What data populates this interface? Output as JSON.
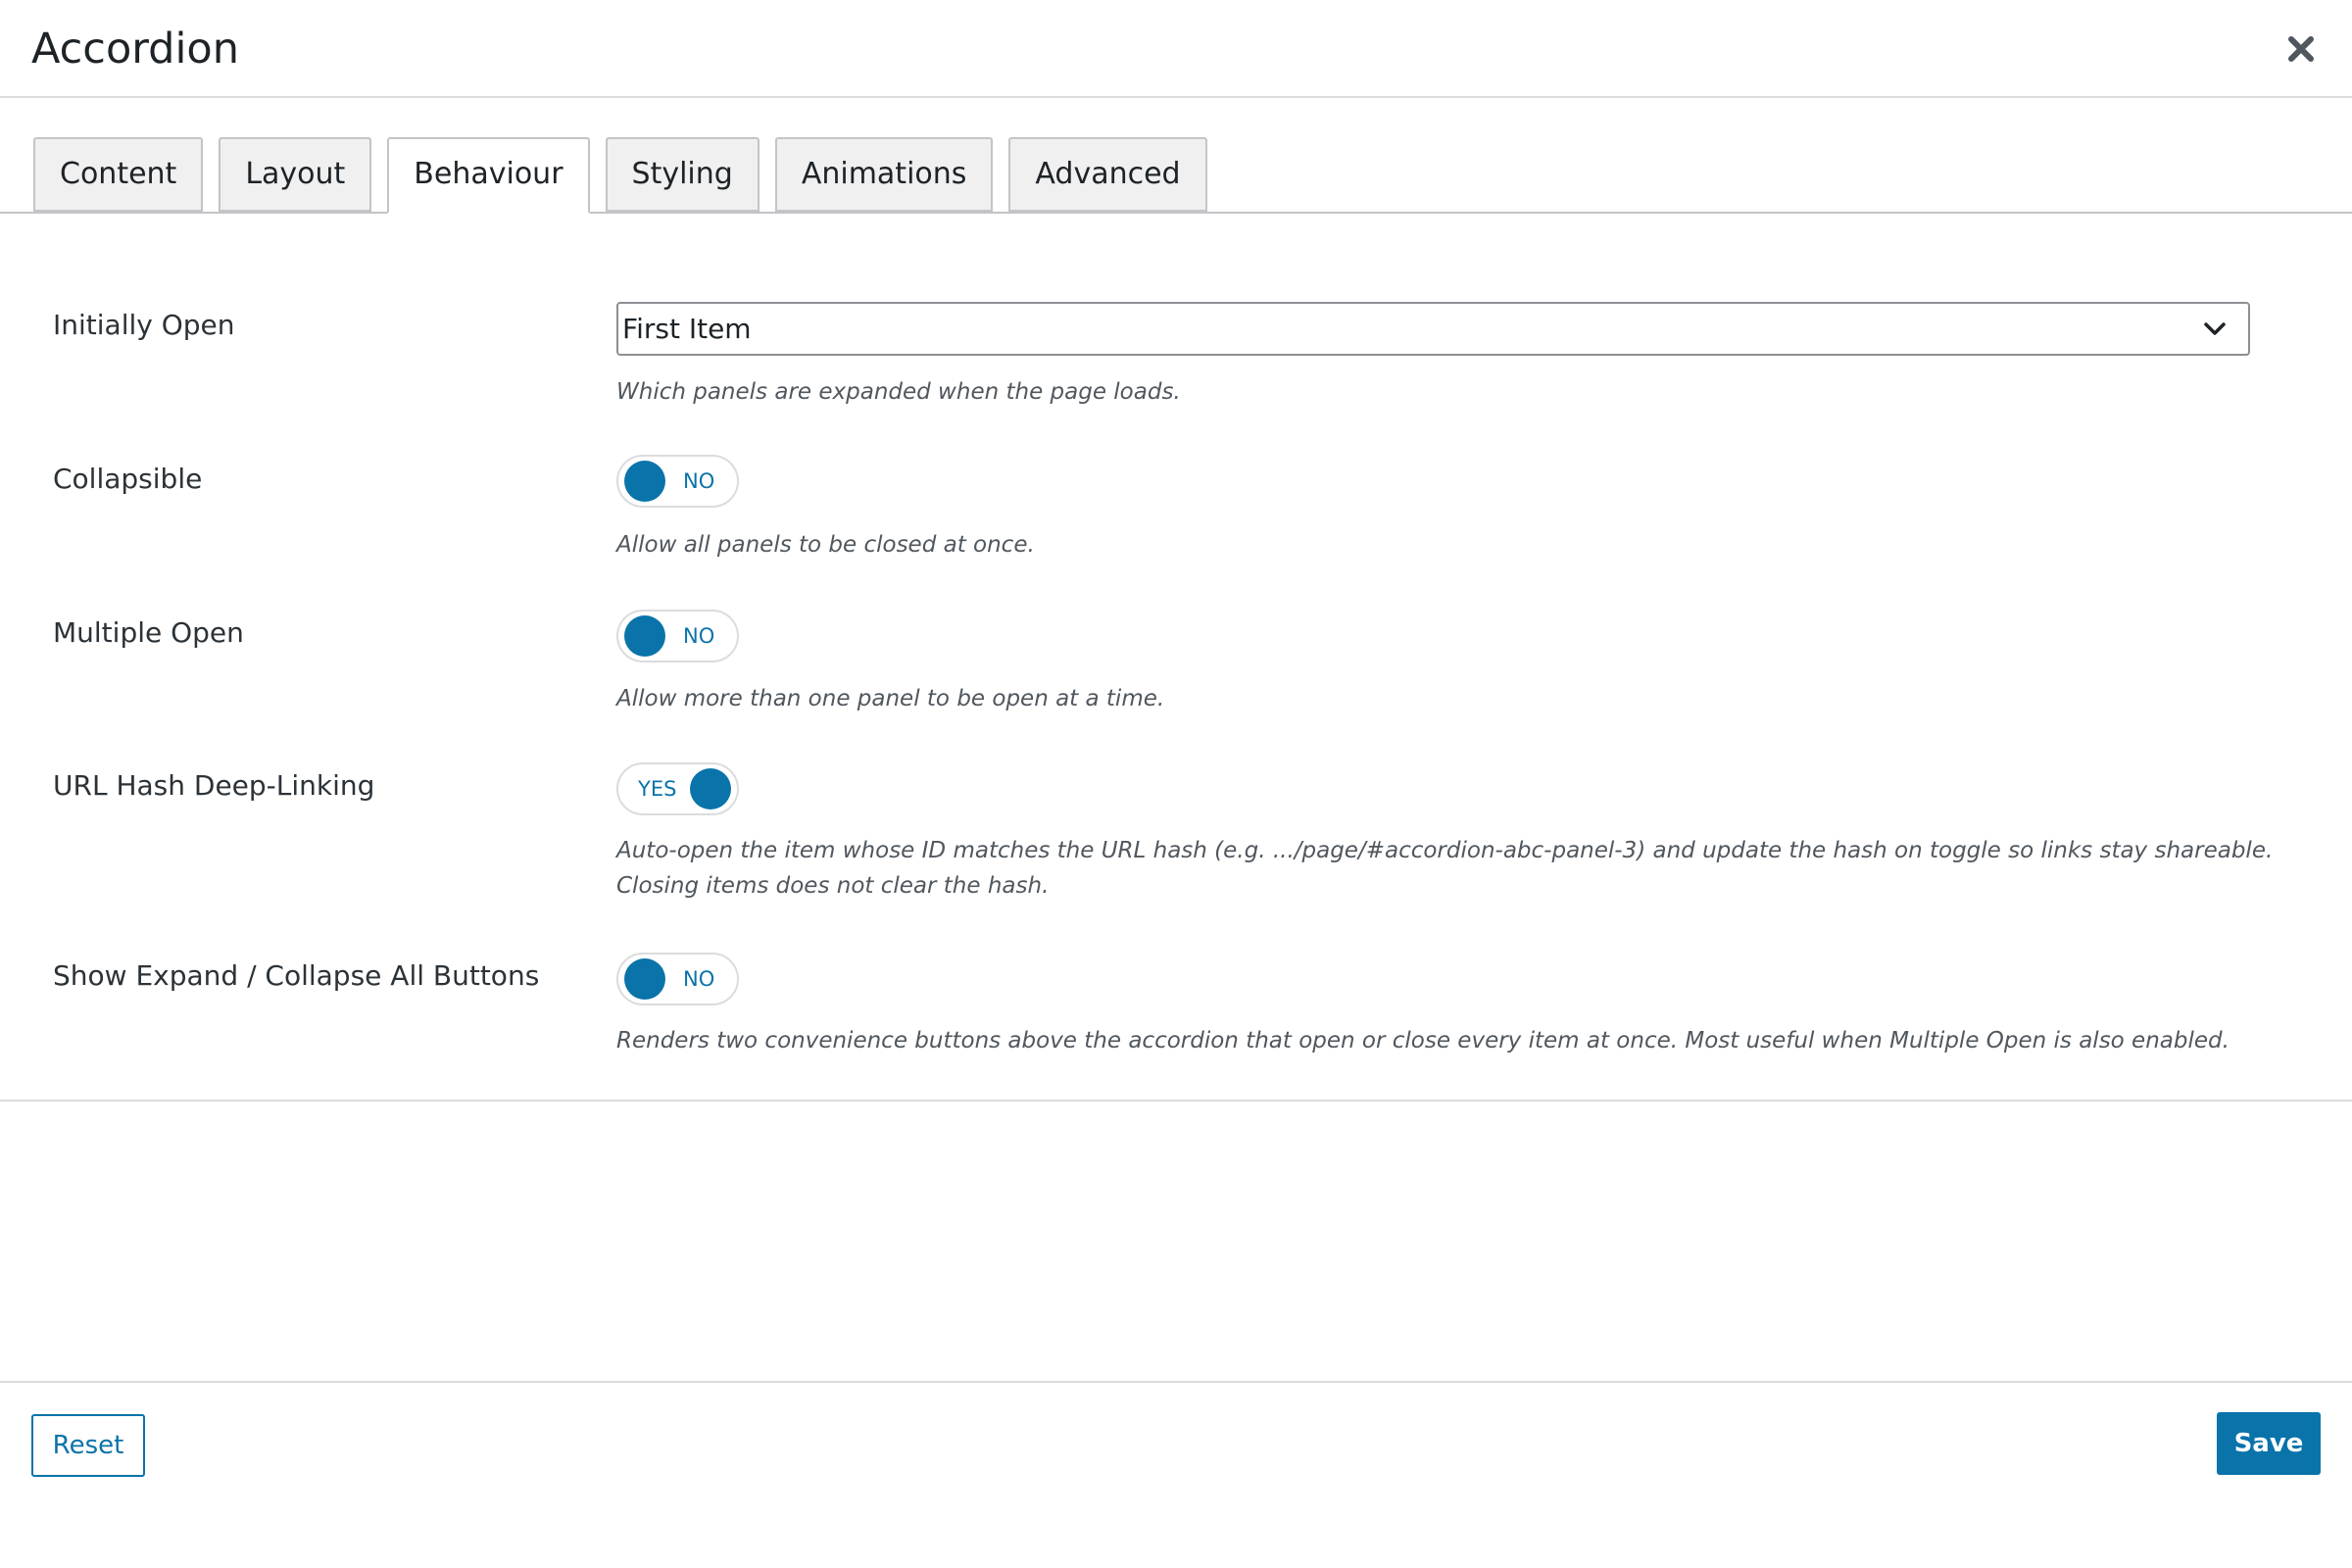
{
  "modal": {
    "title": "Accordion",
    "close_icon": "close-icon"
  },
  "tabs": [
    {
      "label": "Content",
      "active": false
    },
    {
      "label": "Layout",
      "active": false
    },
    {
      "label": "Behaviour",
      "active": true
    },
    {
      "label": "Styling",
      "active": false
    },
    {
      "label": "Animations",
      "active": false
    },
    {
      "label": "Advanced",
      "active": false
    }
  ],
  "settings": {
    "initially_open": {
      "label": "Initially Open",
      "value": "First Item",
      "description": "Which panels are expanded when the page loads."
    },
    "collapsible": {
      "label": "Collapsible",
      "state": "NO",
      "description": "Allow all panels to be closed at once."
    },
    "multiple_open": {
      "label": "Multiple Open",
      "state": "NO",
      "description": "Allow more than one panel to be open at a time."
    },
    "url_hash": {
      "label": "URL Hash Deep-Linking",
      "state": "YES",
      "description": "Auto-open the item whose ID matches the URL hash (e.g. .../page/#accordion-abc-panel-3) and update the hash on toggle so links stay shareable. Closing items does not clear the hash."
    },
    "expand_collapse_buttons": {
      "label": "Show Expand / Collapse All Buttons",
      "state": "NO",
      "description": "Renders two convenience buttons above the accordion that open or close every item at once. Most useful when Multiple Open is also enabled."
    }
  },
  "footer": {
    "reset_label": "Reset",
    "save_label": "Save"
  },
  "colors": {
    "accent": "#0a73aa",
    "border": "#c3c4c7",
    "tab_bg": "#f0f0f1"
  }
}
